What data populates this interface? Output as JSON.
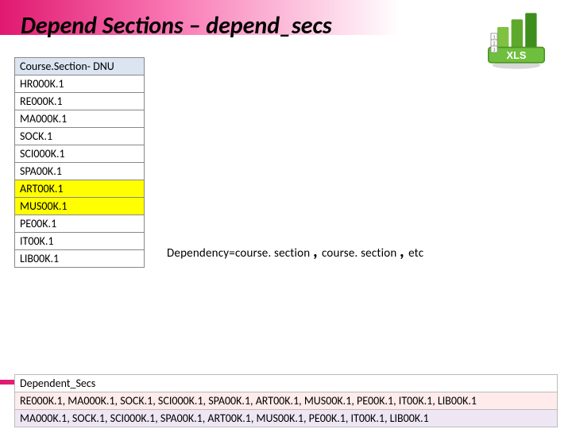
{
  "title": "Depend Sections – depend_secs",
  "icon": "xls-icon",
  "course_table": {
    "header": "Course.Section- DNU",
    "rows": [
      {
        "v": "HR000K.1",
        "hl": false
      },
      {
        "v": "RE000K.1",
        "hl": false
      },
      {
        "v": "MA000K.1",
        "hl": false
      },
      {
        "v": "SOCK.1",
        "hl": false
      },
      {
        "v": "SCI000K.1",
        "hl": false
      },
      {
        "v": "SPA00K.1",
        "hl": false
      },
      {
        "v": "ART00K.1",
        "hl": true
      },
      {
        "v": "MUS00K.1",
        "hl": true
      },
      {
        "v": "PE00K.1",
        "hl": false
      },
      {
        "v": "IT00K.1",
        "hl": false
      },
      {
        "v": "LIB00K.1",
        "hl": false
      }
    ]
  },
  "formula": {
    "p1": "Dependency=course. section",
    "p2": "course. section",
    "p3": "etc"
  },
  "dep_table": {
    "header": "Dependent_Secs",
    "rows": [
      "RE000K.1, MA000K.1, SOCK.1, SCI000K.1, SPA00K.1, ART00K.1, MUS00K.1, PE00K.1, IT00K.1, LIB00K.1",
      "MA000K.1, SOCK.1, SCI000K.1, SPA00K.1, ART00K.1, MUS00K.1, PE00K.1, IT00K.1, LIB00K.1"
    ]
  }
}
